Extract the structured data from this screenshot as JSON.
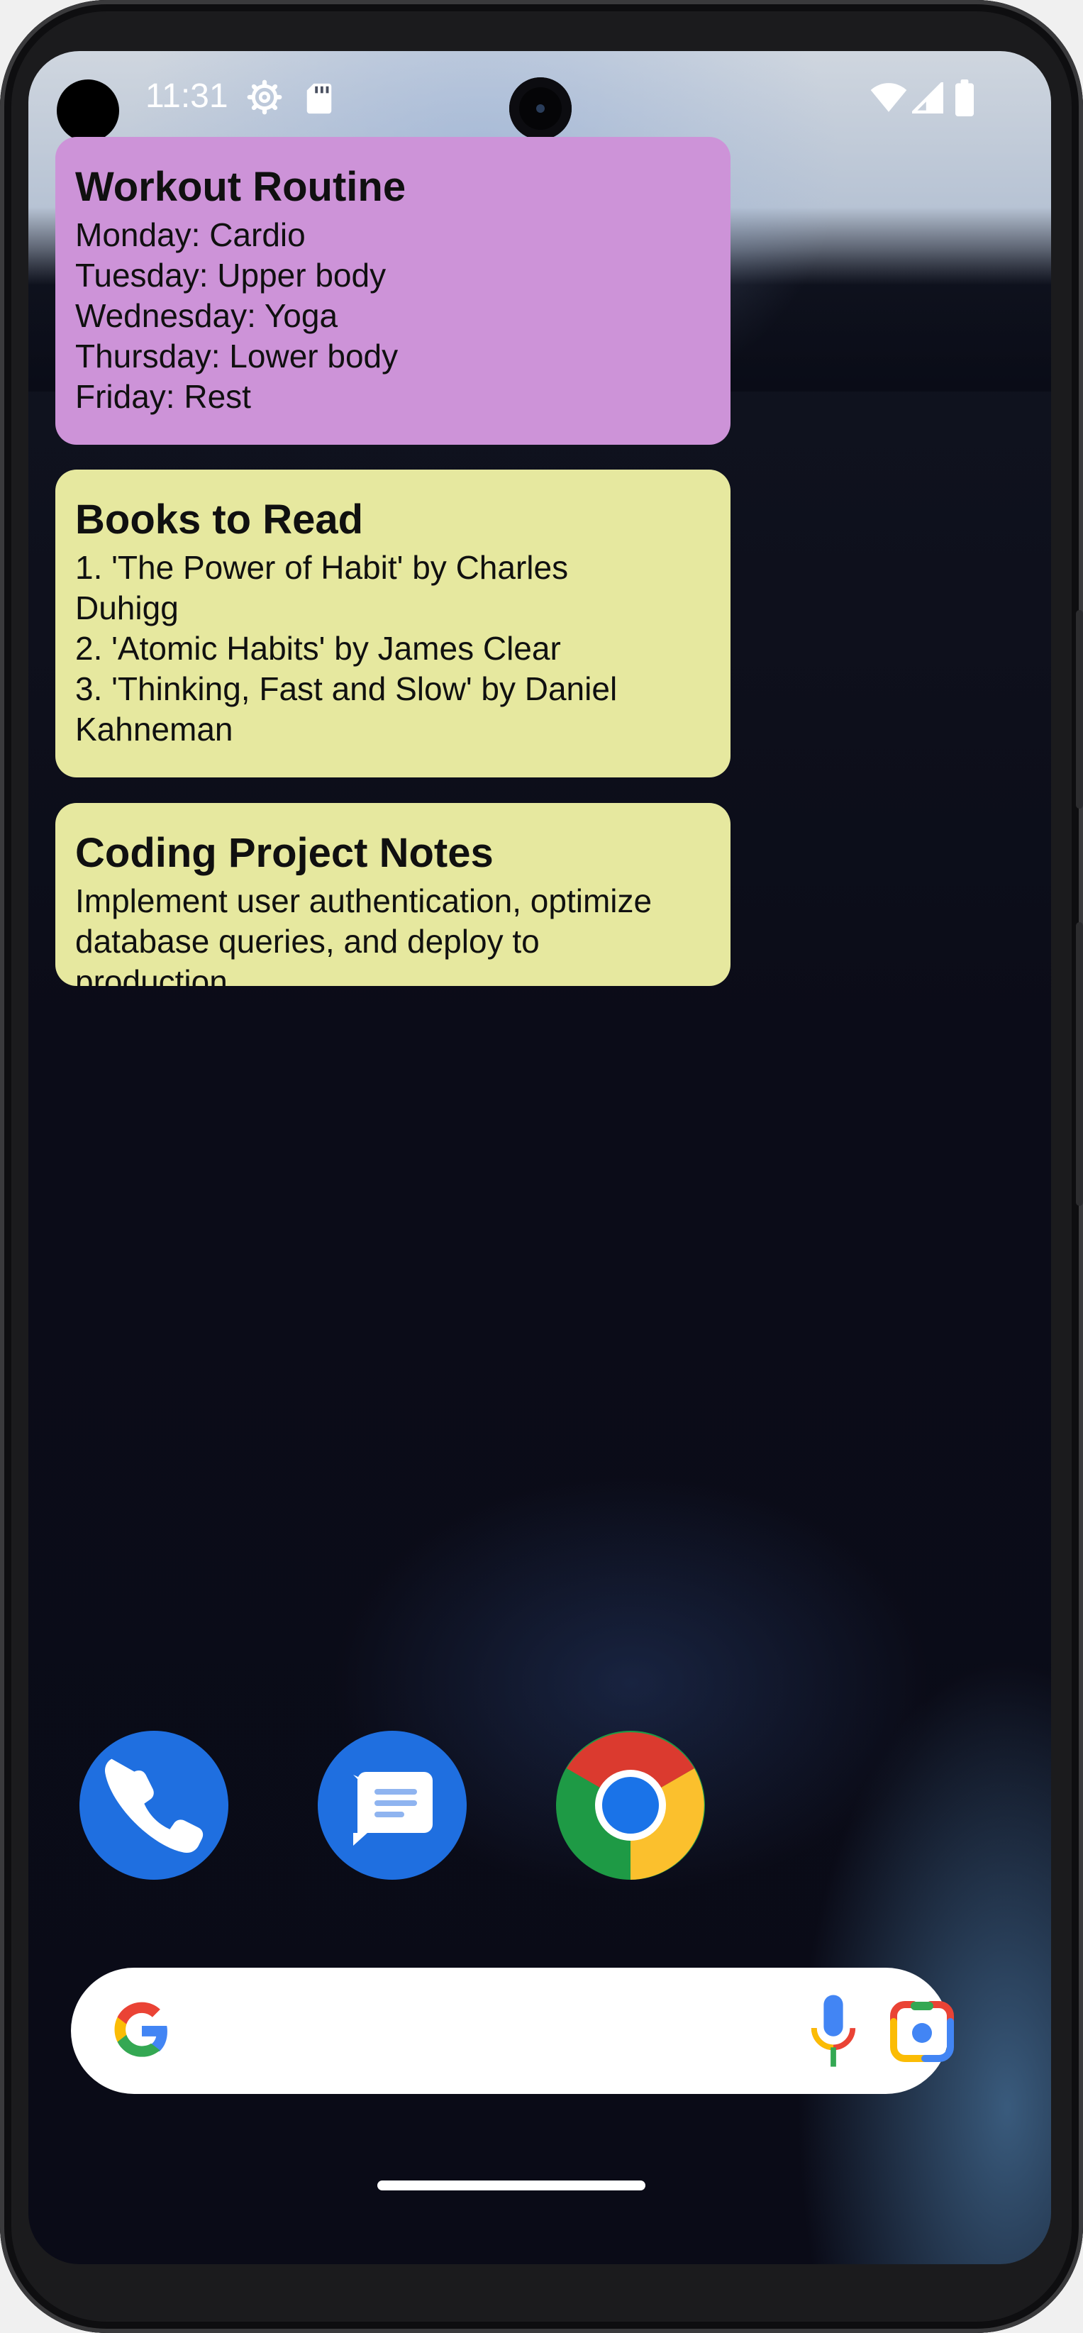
{
  "status_bar": {
    "time": "11:31",
    "icons": [
      "gear-icon",
      "sd-card-icon",
      "wifi-icon",
      "cell-signal-icon",
      "battery-icon"
    ]
  },
  "widgets": [
    {
      "title": "Workout Routine",
      "body": "Monday: Cardio\nTuesday: Upper body\nWednesday: Yoga\nThursday: Lower body\nFriday: Rest",
      "color": "#cd93d8"
    },
    {
      "title": "Books to Read",
      "body": "1. 'The Power of Habit' by Charles\nDuhigg\n2. 'Atomic Habits' by James Clear\n3. 'Thinking, Fast and Slow' by Daniel\nKahneman",
      "color": "#e6e89f"
    },
    {
      "title": "Coding Project Notes",
      "body": "Implement user authentication, optimize\ndatabase queries, and deploy to\nproduction",
      "color": "#e6e89f"
    }
  ],
  "dock": [
    {
      "app": "Phone",
      "icon": "phone-icon"
    },
    {
      "app": "Messages",
      "icon": "messages-icon"
    },
    {
      "app": "Chrome",
      "icon": "chrome-icon"
    }
  ],
  "search_bar": {
    "icons": [
      "google-g-icon",
      "microphone-icon",
      "google-lens-icon"
    ]
  }
}
